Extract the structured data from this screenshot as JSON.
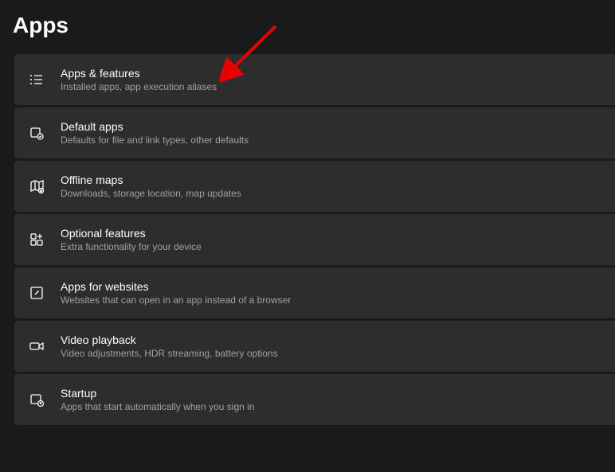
{
  "page": {
    "title": "Apps"
  },
  "items": [
    {
      "title": "Apps & features",
      "description": "Installed apps, app execution aliases"
    },
    {
      "title": "Default apps",
      "description": "Defaults for file and link types, other defaults"
    },
    {
      "title": "Offline maps",
      "description": "Downloads, storage location, map updates"
    },
    {
      "title": "Optional features",
      "description": "Extra functionality for your device"
    },
    {
      "title": "Apps for websites",
      "description": "Websites that can open in an app instead of a browser"
    },
    {
      "title": "Video playback",
      "description": "Video adjustments, HDR streaming, battery options"
    },
    {
      "title": "Startup",
      "description": "Apps that start automatically when you sign in"
    }
  ],
  "annotation": {
    "arrow_color": "#e60000"
  }
}
